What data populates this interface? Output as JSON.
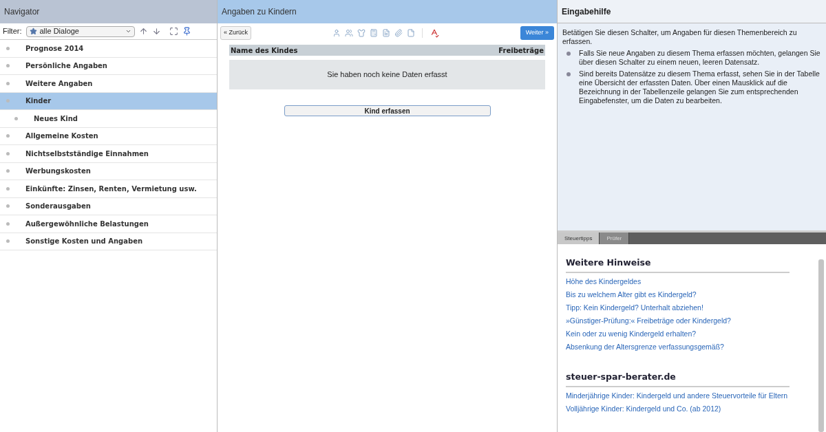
{
  "navigator": {
    "title": "Navigator",
    "filter_label": "Filter:",
    "filter_value": "alle Dialoge",
    "items": [
      {
        "label": "Prognose 2014",
        "selected": false
      },
      {
        "label": "Persönliche Angaben",
        "selected": false
      },
      {
        "label": "Weitere Angaben",
        "selected": false
      },
      {
        "label": "Kinder",
        "selected": true,
        "children": [
          {
            "label": "Neues Kind",
            "selected": false
          }
        ]
      },
      {
        "label": "Allgemeine Kosten",
        "selected": false
      },
      {
        "label": "Nichtselbstständige Einnahmen",
        "selected": false
      },
      {
        "label": "Werbungskosten",
        "selected": false
      },
      {
        "label": "Einkünfte: Zinsen, Renten, Vermietung usw.",
        "selected": false
      },
      {
        "label": "Sonderausgaben",
        "selected": false
      },
      {
        "label": "Außergewöhnliche Belastungen",
        "selected": false
      },
      {
        "label": "Sonstige Kosten und Angaben",
        "selected": false
      }
    ]
  },
  "main": {
    "title": "Angaben zu Kindern",
    "back_button": "« Zurück",
    "next_button": "Weiter »",
    "table": {
      "columns": [
        "Name des Kindes",
        "Freibeträge"
      ],
      "empty_message": "Sie haben noch keine Daten erfasst"
    },
    "add_button": "Kind erfassen"
  },
  "help": {
    "title": "Eingabehilfe",
    "intro": "Betätigen Sie diesen Schalter, um Angaben für diesen Themenbereich zu erfassen.",
    "bullets": [
      "Falls Sie neue Angaben zu diesem Thema erfassen möchten, gelangen Sie über diesen Schalter zu einem neuen, leeren Datensatz.",
      "Sind bereits Datensätze zu diesem Thema erfasst, sehen Sie in der Tabelle eine Übersicht der erfassten Daten. Über einen Mausklick auf die Bezeichnung in der Tabellenzeile gelangen Sie zum entsprechenden Eingabefenster, um die Daten zu bearbeiten."
    ]
  },
  "tips": {
    "tabs": [
      {
        "label": "Steuertipps",
        "selected": true
      },
      {
        "label": "Prüfer",
        "selected": false
      }
    ],
    "sections": [
      {
        "heading": "Weitere Hinweise",
        "links": [
          "Höhe des Kindergeldes",
          "Bis zu welchem Alter gibt es Kindergeld?",
          "Tipp: Kein Kindergeld? Unterhalt abziehen!",
          "»Günstiger-Prüfung:« Freibeträge oder Kindergeld?",
          "Kein oder zu wenig Kindergeld erhalten?",
          "Absenkung der Altersgrenze verfassungsgemäß?"
        ]
      },
      {
        "heading": "steuer-spar-berater.de",
        "links": [
          "Minderjährige Kinder: Kindergeld und andere Steuervorteile für Eltern",
          "Volljährige Kinder: Kindergeld und Co. (ab 2012)"
        ]
      }
    ]
  }
}
